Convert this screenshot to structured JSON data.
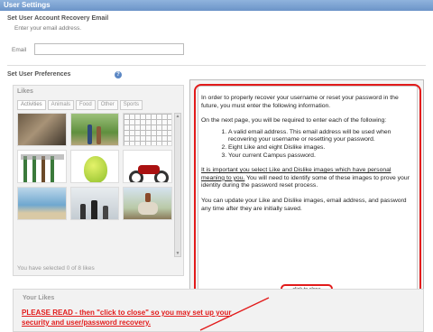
{
  "header": {
    "title": "User Settings"
  },
  "recovery": {
    "title": "Set User Account Recovery Email",
    "subtitle": "Enter your email address.",
    "email_label": "Email",
    "email_value": ""
  },
  "preferences": {
    "title": "Set User Preferences",
    "help_icon": "?"
  },
  "likes": {
    "title": "Likes",
    "tabs": [
      "Activities",
      "Animals",
      "Food",
      "Other",
      "Sports"
    ],
    "active_tab": "Activities",
    "selected_text": "You have selected 0 of 8 likes",
    "images": [
      "cave",
      "people-hiking",
      "sudoku",
      "gardening-tools",
      "hot-air-balloon",
      "motorcycle",
      "beach",
      "chess",
      "horse-riding"
    ]
  },
  "modal": {
    "p1": "In order to properly recover your username or reset your password in the future, you must enter the following information.",
    "p2": "On the next page, you will be required to enter each of the following:",
    "list": [
      "A valid email address. This email address will be used when recovering your username or resetting your password.",
      "Eight Like and eight Dislike images.",
      "Your current Campus password."
    ],
    "p3_underlined": "It is important you select Like and Dislike images which have personal meaning to you.",
    "p3_rest": " You will need to identify some of these images to prove your identity during the password reset process.",
    "p4": "You can update your Like and Dislike images, email address, and password any time after they are initially saved.",
    "close_label": "click to close"
  },
  "your_likes": {
    "title": "Your Likes"
  },
  "notice": "PLEASE READ - then \"click to close\" so you may set up your security and user/password recovery.",
  "colors": {
    "accent_red": "#e21b1b",
    "title_bar": "#6c94c8"
  }
}
